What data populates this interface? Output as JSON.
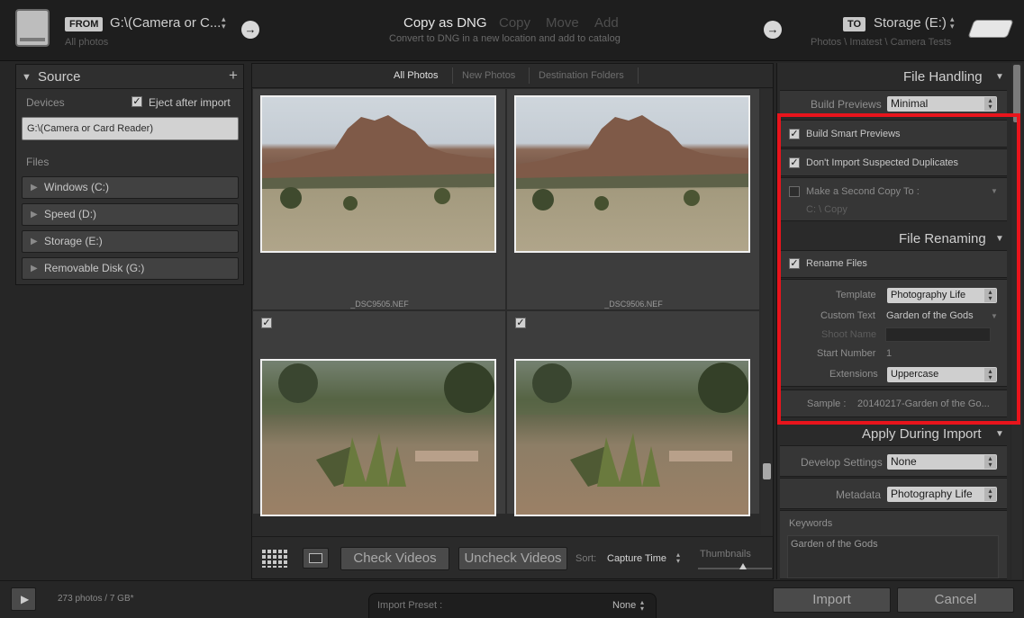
{
  "header": {
    "from_label": "FROM",
    "from_source": "G:\\(Camera or C...",
    "from_sub": "All photos",
    "mode_active": "Copy as DNG",
    "mode_copy": "Copy",
    "mode_move": "Move",
    "mode_add": "Add",
    "mode_description": "Convert to DNG in a new location and add to catalog",
    "to_label": "TO",
    "to_dest": "Storage (E:)",
    "to_path": "Photos \\ Imatest \\ Camera Tests"
  },
  "source": {
    "title": "Source",
    "devices_label": "Devices",
    "eject_label": "Eject after import",
    "eject_checked": true,
    "device_selected": "G:\\(Camera or Card Reader)",
    "files_label": "Files",
    "drives": [
      "Windows (C:)",
      "Speed (D:)",
      "Storage (E:)",
      "Removable Disk (G:)"
    ],
    "photo_count": "273 photos / 7 GB*"
  },
  "grid": {
    "tabs": [
      "All Photos",
      "New Photos",
      "Destination Folders"
    ],
    "items": [
      {
        "name": "_DSC9505.NEF"
      },
      {
        "name": "_DSC9506.NEF"
      },
      {
        "name": ""
      },
      {
        "name": ""
      }
    ],
    "check_videos": "Check Videos",
    "uncheck_videos": "Uncheck Videos",
    "sort_label": "Sort:",
    "sort_value": "Capture Time",
    "thumbnails_label": "Thumbnails"
  },
  "file_handling": {
    "title": "File Handling",
    "build_previews_label": "Build Previews",
    "build_previews_value": "Minimal",
    "smart_previews_label": "Build Smart Previews",
    "no_duplicates_label": "Don't Import Suspected Duplicates",
    "second_copy_label": "Make a Second Copy To :",
    "second_copy_path": "C: \\ Copy"
  },
  "file_renaming": {
    "title": "File Renaming",
    "rename_label": "Rename Files",
    "template_label": "Template",
    "template_value": "Photography Life",
    "custom_text_label": "Custom Text",
    "custom_text_value": "Garden of the Gods",
    "shoot_name_label": "Shoot Name",
    "start_number_label": "Start Number",
    "start_number_value": "1",
    "extensions_label": "Extensions",
    "extensions_value": "Uppercase",
    "sample_label": "Sample :",
    "sample_value": "20140217-Garden of the Go..."
  },
  "apply_during_import": {
    "title": "Apply During Import",
    "develop_label": "Develop Settings",
    "develop_value": "None",
    "metadata_label": "Metadata",
    "metadata_value": "Photography Life",
    "keywords_label": "Keywords",
    "keywords_value": "Garden of the Gods"
  },
  "footer": {
    "preset_label": "Import Preset :",
    "preset_value": "None",
    "import_button": "Import",
    "cancel_button": "Cancel"
  },
  "colors": {
    "highlight": "#e8141c",
    "background": "#262626"
  }
}
